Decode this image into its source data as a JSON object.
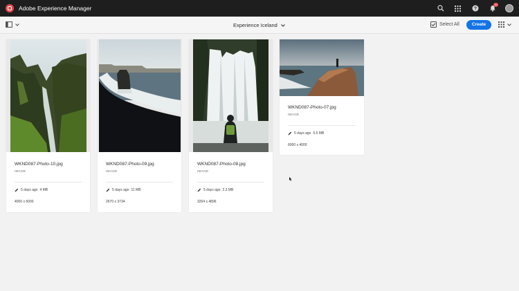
{
  "shell": {
    "app_title": "Adobe Experience Manager",
    "notification_count": "10",
    "icons": [
      "search-icon",
      "apps-grid-icon",
      "help-icon",
      "bell-icon",
      "user-avatar"
    ]
  },
  "actionbar": {
    "breadcrumb_title": "Experience Iceland",
    "select_all_label": "Select All",
    "create_label": "Create",
    "accent_color": "#1473e6"
  },
  "assets": [
    {
      "name": "WKND087-Photo-10.jpg",
      "type": "IMAGE",
      "modified": "5 days ago",
      "size": "4 MB",
      "dimensions": "4000 x 6000"
    },
    {
      "name": "WKND087-Photo-09.jpg",
      "type": "IMAGE",
      "modified": "5 days ago",
      "size": "11 MB",
      "dimensions": "2670 x 3734"
    },
    {
      "name": "WKND087-Photo-08.jpg",
      "type": "IMAGE",
      "modified": "5 days ago",
      "size": "2.3 MB",
      "dimensions": "3264 x 4896"
    },
    {
      "name": "WKND087-Photo-07.jpg",
      "type": "IMAGE",
      "modified": "5 days ago",
      "size": "5.5 MB",
      "dimensions": "6000 x 4000"
    }
  ]
}
